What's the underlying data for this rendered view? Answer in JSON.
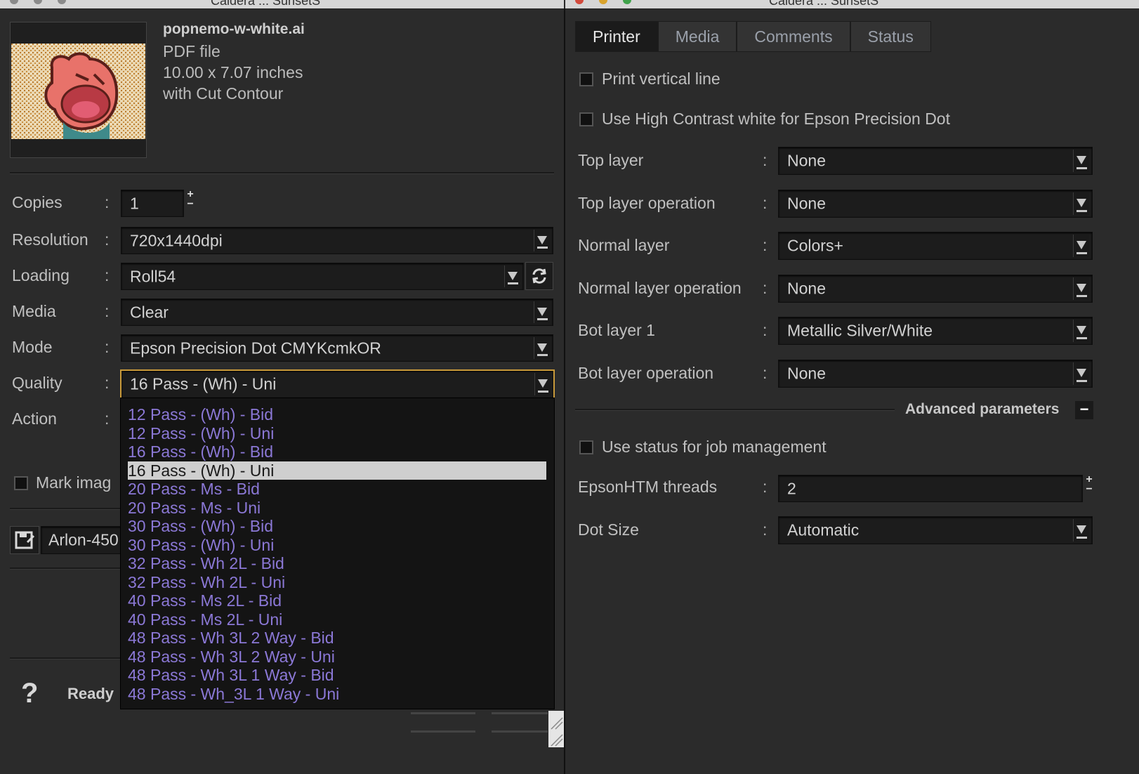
{
  "window_left": {
    "title": "Caldera ... SunsetS"
  },
  "window_right": {
    "title": "Caldera ... SunsetS"
  },
  "file": {
    "name": "popnemo-w-white.ai",
    "type": "PDF file",
    "size": "10.00 x 7.07 inches",
    "extra": "with Cut Contour"
  },
  "form": {
    "copies_label": "Copies",
    "copies_value": "1",
    "resolution_label": "Resolution",
    "resolution_value": "720x1440dpi",
    "loading_label": "Loading",
    "loading_value": "Roll54",
    "media_label": "Media",
    "media_value": "Clear",
    "mode_label": "Mode",
    "mode_value": "Epson Precision Dot CMYKcmkOR",
    "quality_label": "Quality",
    "quality_value": "16 Pass - (Wh) - Uni",
    "action_label": "Action",
    "colon": ":",
    "mark_image_label": "Mark imag",
    "preset_value": "Arlon-450"
  },
  "quality_options": [
    "12 Pass - (Wh) - Bid",
    "12 Pass - (Wh) - Uni",
    "16 Pass - (Wh) - Bid",
    "16 Pass - (Wh) - Uni",
    "20 Pass - Ms - Bid",
    "20 Pass - Ms - Uni",
    "30 Pass - (Wh) - Bid",
    "30 Pass - (Wh) - Uni",
    "32 Pass - Wh 2L - Bid",
    "32 Pass - Wh 2L - Uni",
    "40 Pass - Ms 2L - Bid",
    "40 Pass - Ms 2L - Uni",
    "48 Pass - Wh 3L 2 Way - Bid",
    "48 Pass - Wh 3L 2 Way - Uni",
    "48 Pass - Wh 3L 1 Way - Bid",
    "48 Pass - Wh_3L 1 Way - Uni"
  ],
  "quality_selected_index": 3,
  "status": {
    "help": "?",
    "text": "Ready"
  },
  "tabs": [
    "Printer",
    "Media",
    "Comments",
    "Status"
  ],
  "active_tab": "Printer",
  "printer": {
    "print_vertical_line": "Print vertical line",
    "high_contrast": "Use High Contrast white for Epson Precision Dot",
    "top_layer_label": "Top layer",
    "top_layer_value": "None",
    "top_layer_op_label": "Top layer operation",
    "top_layer_op_value": "None",
    "normal_layer_label": "Normal layer",
    "normal_layer_value": "Colors+",
    "normal_layer_op_label": "Normal layer operation",
    "normal_layer_op_value": "None",
    "bot_layer_label": "Bot layer 1",
    "bot_layer_value": "Metallic Silver/White",
    "bot_layer_op_label": "Bot layer operation",
    "bot_layer_op_value": "None",
    "advanced_label": "Advanced parameters",
    "advanced_toggle": "−",
    "use_status_label": "Use status for job management",
    "threads_label": "EpsonHTM threads",
    "threads_value": "2",
    "dot_size_label": "Dot Size",
    "dot_size_value": "Automatic"
  },
  "colors": {
    "background": "#2a2a2a",
    "field": "#1c1c1c",
    "option_text": "#8b78d6",
    "focus_border": "#c99a3a",
    "selected_row": "#cfcfcf"
  }
}
